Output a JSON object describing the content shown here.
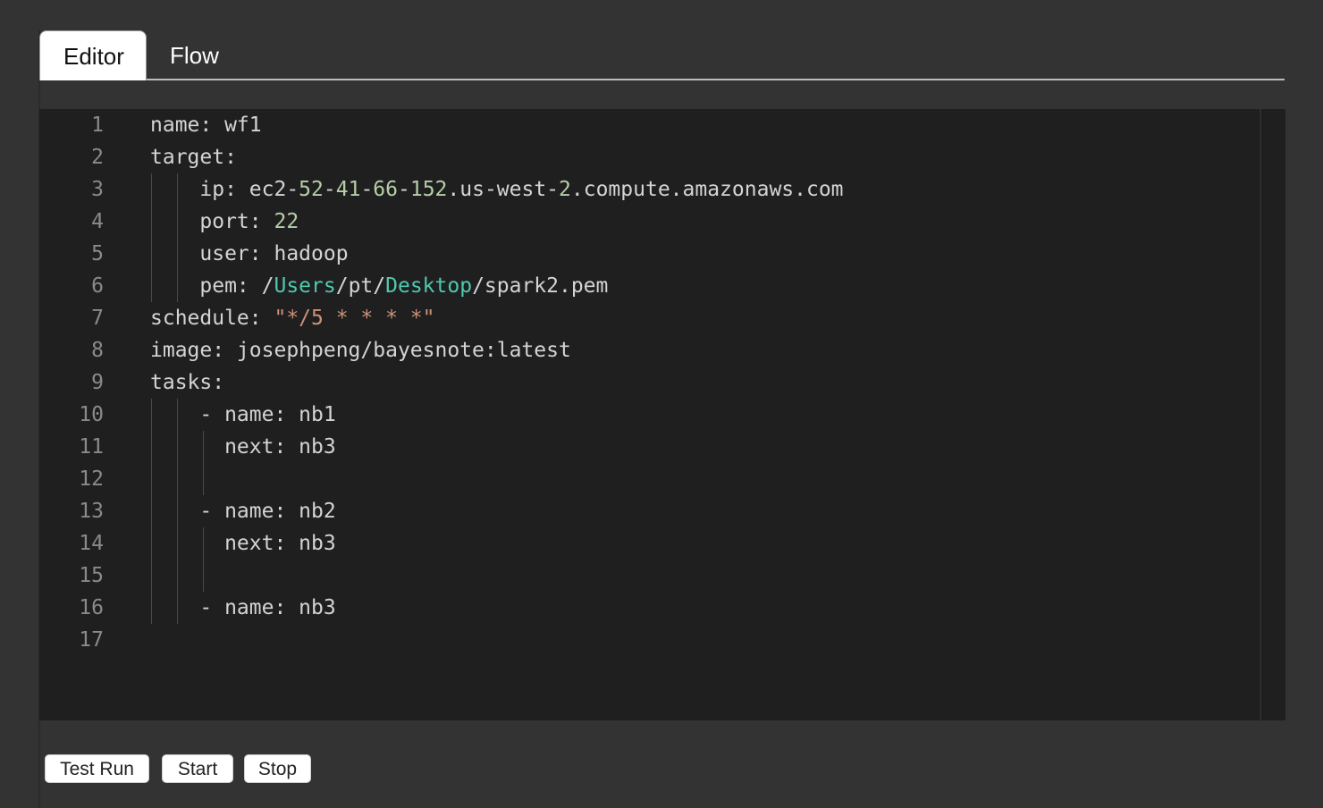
{
  "tabs": [
    {
      "label": "Editor",
      "active": true
    },
    {
      "label": "Flow",
      "active": false
    }
  ],
  "editor": {
    "language": "yaml",
    "line_numbers": [
      "1",
      "2",
      "3",
      "4",
      "5",
      "6",
      "7",
      "8",
      "9",
      "10",
      "11",
      "12",
      "13",
      "14",
      "15",
      "16",
      "17"
    ],
    "lines": [
      [
        {
          "t": "name: wf1",
          "c": "plain"
        }
      ],
      [
        {
          "t": "target:",
          "c": "plain"
        }
      ],
      [
        {
          "t": "    ip: ec2-",
          "c": "plain"
        },
        {
          "t": "52",
          "c": "num"
        },
        {
          "t": "-",
          "c": "plain"
        },
        {
          "t": "41",
          "c": "num"
        },
        {
          "t": "-",
          "c": "plain"
        },
        {
          "t": "66",
          "c": "num"
        },
        {
          "t": "-",
          "c": "plain"
        },
        {
          "t": "152",
          "c": "num"
        },
        {
          "t": ".us-west-",
          "c": "plain"
        },
        {
          "t": "2",
          "c": "num"
        },
        {
          "t": ".compute.amazonaws.com",
          "c": "plain"
        }
      ],
      [
        {
          "t": "    port: ",
          "c": "plain"
        },
        {
          "t": "22",
          "c": "num"
        }
      ],
      [
        {
          "t": "    user: hadoop",
          "c": "plain"
        }
      ],
      [
        {
          "t": "    pem: /",
          "c": "plain"
        },
        {
          "t": "Users",
          "c": "path"
        },
        {
          "t": "/pt/",
          "c": "plain"
        },
        {
          "t": "Desktop",
          "c": "path"
        },
        {
          "t": "/spark2.pem",
          "c": "plain"
        }
      ],
      [
        {
          "t": "schedule: ",
          "c": "plain"
        },
        {
          "t": "\"*/5 * * * *\"",
          "c": "str"
        }
      ],
      [
        {
          "t": "image: josephpeng/bayesnote:latest",
          "c": "plain"
        }
      ],
      [
        {
          "t": "tasks:",
          "c": "plain"
        }
      ],
      [
        {
          "t": "    - name: nb1",
          "c": "plain"
        }
      ],
      [
        {
          "t": "      next: nb3",
          "c": "plain"
        }
      ],
      [
        {
          "t": "",
          "c": "plain"
        }
      ],
      [
        {
          "t": "    - name: nb2",
          "c": "plain"
        }
      ],
      [
        {
          "t": "      next: nb3",
          "c": "plain"
        }
      ],
      [
        {
          "t": "",
          "c": "plain"
        }
      ],
      [
        {
          "t": "    - name: nb3",
          "c": "plain"
        }
      ],
      [
        {
          "t": "",
          "c": "plain"
        }
      ]
    ]
  },
  "buttons": {
    "test_run": "Test Run",
    "start": "Start",
    "stop": "Stop"
  }
}
